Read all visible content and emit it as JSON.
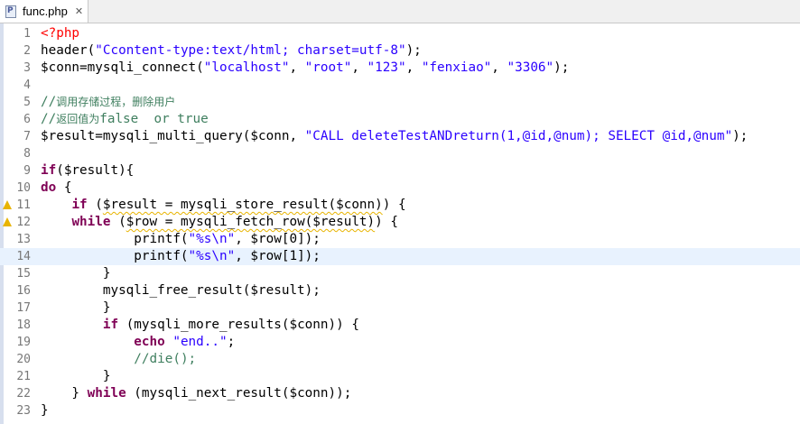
{
  "tab": {
    "title": "func.php",
    "close_glyph": "✕"
  },
  "editor": {
    "current_line": 14,
    "warning_lines": [
      11,
      12
    ],
    "lines": [
      {
        "n": "1",
        "parts": [
          {
            "t": "<?php",
            "c": "tag"
          }
        ]
      },
      {
        "n": "2",
        "parts": [
          {
            "t": "header(",
            "c": ""
          },
          {
            "t": "\"Ccontent-type:text/html; charset=utf-8\"",
            "c": "str"
          },
          {
            "t": ");",
            "c": ""
          }
        ]
      },
      {
        "n": "3",
        "parts": [
          {
            "t": "$conn=mysqli_connect(",
            "c": ""
          },
          {
            "t": "\"localhost\"",
            "c": "str"
          },
          {
            "t": ", ",
            "c": ""
          },
          {
            "t": "\"root\"",
            "c": "str"
          },
          {
            "t": ", ",
            "c": ""
          },
          {
            "t": "\"123\"",
            "c": "str"
          },
          {
            "t": ", ",
            "c": ""
          },
          {
            "t": "\"fenxiao\"",
            "c": "str"
          },
          {
            "t": ", ",
            "c": ""
          },
          {
            "t": "\"3306\"",
            "c": "str"
          },
          {
            "t": ");",
            "c": ""
          }
        ]
      },
      {
        "n": "4",
        "parts": []
      },
      {
        "n": "5",
        "parts": [
          {
            "t": "//",
            "c": "cmt"
          },
          {
            "t": "调用存储过程，删除用户",
            "c": "cmt cmtcn"
          }
        ]
      },
      {
        "n": "6",
        "parts": [
          {
            "t": "//",
            "c": "cmt"
          },
          {
            "t": "返回值为",
            "c": "cmt cmtcn"
          },
          {
            "t": "false  or true",
            "c": "cmt"
          }
        ]
      },
      {
        "n": "7",
        "parts": [
          {
            "t": "$result=mysqli_multi_query($conn, ",
            "c": ""
          },
          {
            "t": "\"CALL deleteTestANDreturn(1,@id,@num); SELECT @id,@num\"",
            "c": "str"
          },
          {
            "t": ");",
            "c": ""
          }
        ]
      },
      {
        "n": "8",
        "parts": []
      },
      {
        "n": "9",
        "parts": [
          {
            "t": "if",
            "c": "kw"
          },
          {
            "t": "($result){",
            "c": ""
          }
        ]
      },
      {
        "n": "10",
        "parts": [
          {
            "t": "do",
            "c": "kw"
          },
          {
            "t": " {",
            "c": ""
          }
        ]
      },
      {
        "n": "11",
        "parts": [
          {
            "t": "    ",
            "c": ""
          },
          {
            "t": "if",
            "c": "kw"
          },
          {
            "t": " (",
            "c": ""
          },
          {
            "t": "$result = mysqli_store_result($conn)",
            "c": "warnsq"
          },
          {
            "t": ") {",
            "c": ""
          }
        ]
      },
      {
        "n": "12",
        "parts": [
          {
            "t": "    ",
            "c": ""
          },
          {
            "t": "while",
            "c": "kw"
          },
          {
            "t": " (",
            "c": ""
          },
          {
            "t": "$row = mysqli_fetch_row($result)",
            "c": "warnsq"
          },
          {
            "t": ") {",
            "c": ""
          }
        ]
      },
      {
        "n": "13",
        "parts": [
          {
            "t": "            printf(",
            "c": ""
          },
          {
            "t": "\"%s\\n\"",
            "c": "str"
          },
          {
            "t": ", $row[0]);",
            "c": ""
          }
        ]
      },
      {
        "n": "14",
        "parts": [
          {
            "t": "            printf(",
            "c": ""
          },
          {
            "t": "\"%s\\n\"",
            "c": "str"
          },
          {
            "t": ", $row[1]);",
            "c": ""
          }
        ]
      },
      {
        "n": "15",
        "parts": [
          {
            "t": "        }",
            "c": ""
          }
        ]
      },
      {
        "n": "16",
        "parts": [
          {
            "t": "        mysqli_free_result($result);",
            "c": ""
          }
        ]
      },
      {
        "n": "17",
        "parts": [
          {
            "t": "        }",
            "c": ""
          }
        ]
      },
      {
        "n": "18",
        "parts": [
          {
            "t": "        ",
            "c": ""
          },
          {
            "t": "if",
            "c": "kw"
          },
          {
            "t": " (mysqli_more_results($conn)) {",
            "c": ""
          }
        ]
      },
      {
        "n": "19",
        "parts": [
          {
            "t": "            ",
            "c": ""
          },
          {
            "t": "echo",
            "c": "kw"
          },
          {
            "t": " ",
            "c": ""
          },
          {
            "t": "\"end..\"",
            "c": "str"
          },
          {
            "t": ";",
            "c": ""
          }
        ]
      },
      {
        "n": "20",
        "parts": [
          {
            "t": "            ",
            "c": ""
          },
          {
            "t": "//die();",
            "c": "cmt"
          }
        ]
      },
      {
        "n": "21",
        "parts": [
          {
            "t": "        }",
            "c": ""
          }
        ]
      },
      {
        "n": "22",
        "parts": [
          {
            "t": "    } ",
            "c": ""
          },
          {
            "t": "while",
            "c": "kw"
          },
          {
            "t": " (mysqli_next_result($conn));",
            "c": ""
          }
        ]
      },
      {
        "n": "23",
        "parts": [
          {
            "t": "}",
            "c": ""
          }
        ]
      }
    ]
  }
}
